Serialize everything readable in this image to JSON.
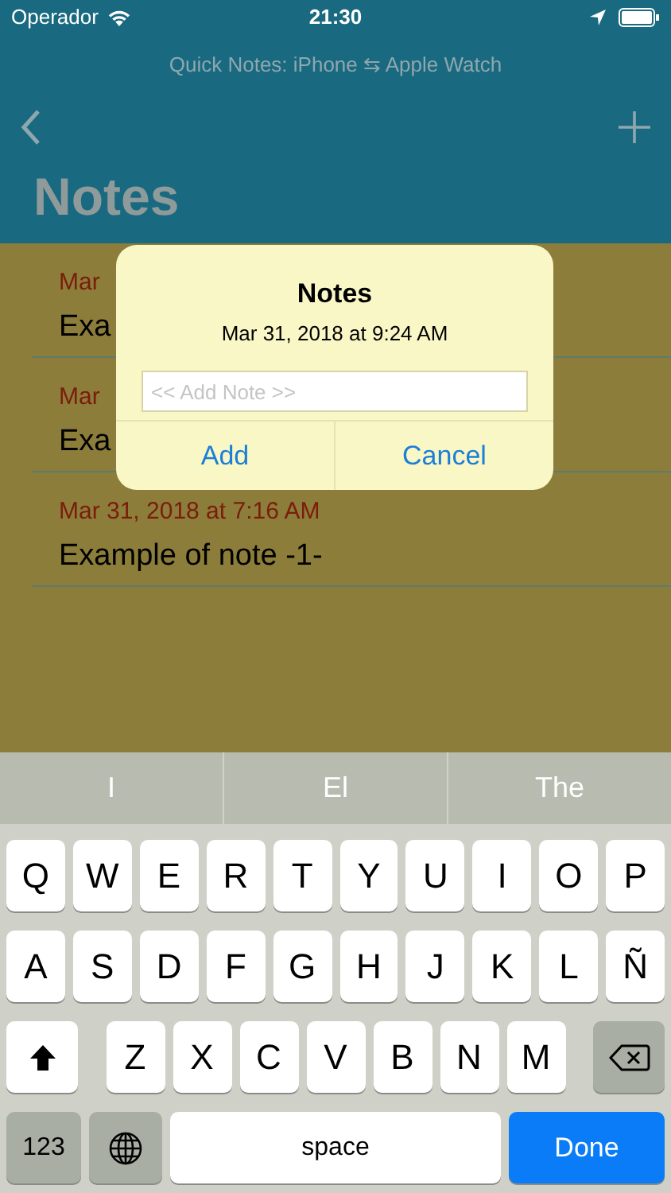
{
  "status_bar": {
    "carrier": "Operador",
    "time": "21:30"
  },
  "app_subtitle": "Quick Notes: iPhone ⇆ Apple Watch",
  "nav": {
    "title": "Notes"
  },
  "notes": [
    {
      "date": "Mar",
      "text": "Exa"
    },
    {
      "date": "Mar",
      "text": "Exa"
    },
    {
      "date": "Mar 31, 2018 at 7:16 AM",
      "text": "Example of note -1-"
    }
  ],
  "dialog": {
    "title": "Notes",
    "subtitle": "Mar 31, 2018 at 9:24 AM",
    "field": {
      "placeholder": "<< Add Note >>"
    },
    "buttons": [
      "Add",
      "Cancel"
    ]
  },
  "suggestions": [
    "I",
    "El",
    "The"
  ],
  "keyboard": [
    [
      {
        "kind": "letter",
        "label": "Q"
      },
      {
        "kind": "letter",
        "label": "W"
      },
      {
        "kind": "letter",
        "label": "E"
      },
      {
        "kind": "letter",
        "label": "R"
      },
      {
        "kind": "letter",
        "label": "T"
      },
      {
        "kind": "letter",
        "label": "Y"
      },
      {
        "kind": "letter",
        "label": "U"
      },
      {
        "kind": "letter",
        "label": "I"
      },
      {
        "kind": "letter",
        "label": "O"
      },
      {
        "kind": "letter",
        "label": "P"
      }
    ],
    [
      {
        "kind": "letter",
        "label": "A"
      },
      {
        "kind": "letter",
        "label": "S"
      },
      {
        "kind": "letter",
        "label": "D"
      },
      {
        "kind": "letter",
        "label": "F"
      },
      {
        "kind": "letter",
        "label": "G"
      },
      {
        "kind": "letter",
        "label": "H"
      },
      {
        "kind": "letter",
        "label": "J"
      },
      {
        "kind": "letter",
        "label": "K"
      },
      {
        "kind": "letter",
        "label": "L"
      },
      {
        "kind": "letter",
        "label": "Ñ"
      }
    ],
    [
      {
        "kind": "shift"
      },
      {
        "kind": "letter",
        "label": "Z"
      },
      {
        "kind": "letter",
        "label": "X"
      },
      {
        "kind": "letter",
        "label": "C"
      },
      {
        "kind": "letter",
        "label": "V"
      },
      {
        "kind": "letter",
        "label": "B"
      },
      {
        "kind": "letter",
        "label": "N"
      },
      {
        "kind": "letter",
        "label": "M"
      },
      {
        "kind": "delete"
      }
    ],
    [
      {
        "kind": "numbers",
        "label": "123"
      },
      {
        "kind": "globe"
      },
      {
        "kind": "space",
        "label": "space"
      },
      {
        "kind": "done",
        "label": "Done"
      }
    ]
  ]
}
